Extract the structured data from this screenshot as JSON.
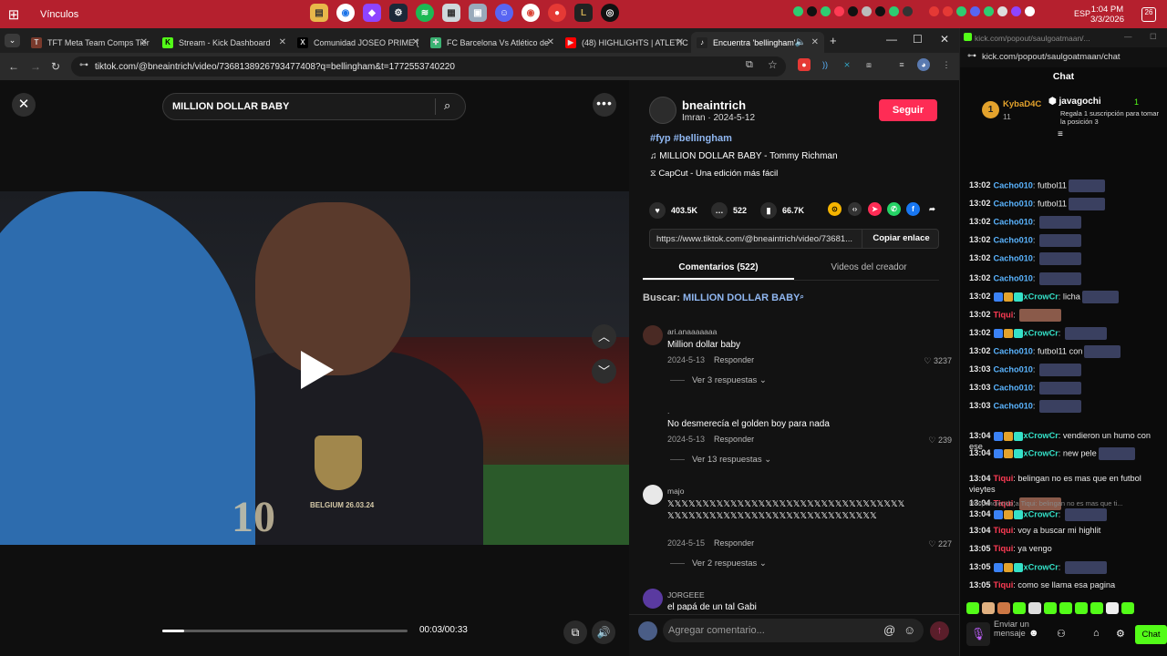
{
  "taskbar": {
    "label": "Vínculos",
    "time": "1:04 PM",
    "date": "3/3/2026",
    "lang": "ESP"
  },
  "browser": {
    "tabs": [
      {
        "label": "TFT Meta Team Comps Tier",
        "icon": "tft-icon",
        "color": "#7a3a2c",
        "glyph": "T"
      },
      {
        "label": "Stream - Kick Dashboard",
        "icon": "kick-icon",
        "color": "#53fc18",
        "glyph": "K"
      },
      {
        "label": "Comunidad JOSEO PRIME (",
        "icon": "x-icon",
        "color": "#000000",
        "glyph": "X"
      },
      {
        "label": "FC Barcelona Vs Atlético de",
        "icon": "globe-icon",
        "color": "#3bb273",
        "glyph": "✚"
      },
      {
        "label": "(48) HIGHLIGHTS | ATLETIC",
        "icon": "youtube-icon",
        "color": "#ff0000",
        "glyph": "▶"
      },
      {
        "label": "Encuentra 'bellingham'",
        "icon": "tiktok-icon",
        "color": "#222222",
        "glyph": "♪"
      }
    ],
    "url": "tiktok.com/@bneaintrich/video/7368138926793477408?q=bellingham&t=1772553740220"
  },
  "video": {
    "search_value": "MILLION DOLLAR BABY",
    "time": "00:03/00:33",
    "progress": 0.09,
    "shirt_text": "BELGIUM 26.03.24",
    "number": "10"
  },
  "post": {
    "username": "bneaintrich",
    "subtitle": "Imran · 2024-5-12",
    "follow_label": "Seguir",
    "tags": "#fyp #bellingham",
    "music": "MILLION DOLLAR BABY - Tommy Richman",
    "capcut": "CapCut - Una edición más fácil",
    "likes": "403.5K",
    "comments": "522",
    "saves": "66.7K",
    "link": "https://www.tiktok.com/@bneaintrich/video/73681...",
    "copy_label": "Copiar enlace",
    "tab_comments": "Comentarios (522)",
    "tab_videos": "Videos del creador",
    "buscar_label": "Buscar:",
    "buscar_query": "MILLION DOLLAR BABY",
    "composer_placeholder": "Agregar comentario..."
  },
  "comments": [
    {
      "user": "ari.anaaaaaaa",
      "text": "Million dollar baby",
      "date": "2024-5-13",
      "reply": "Responder",
      "likes": "3237",
      "replies": "Ver 3 respuestas"
    },
    {
      "user": ".",
      "text": "No desmerecía el golden boy para nada",
      "date": "2024-5-13",
      "reply": "Responder",
      "likes": "239",
      "replies": "Ver 13 respuestas"
    },
    {
      "user": "majo",
      "text": "𝕏𝕏𝕏𝕏𝕏𝕏𝕏𝕏𝕏𝕏𝕏𝕏𝕏𝕏𝕏𝕏𝕏𝕏𝕏𝕏𝕏𝕏𝕏𝕏𝕏𝕏𝕏𝕏𝕏𝕏𝕏𝕏𝕏𝕏𝕏𝕏𝕏𝕏𝕏𝕏𝕏𝕏𝕏𝕏𝕏𝕏𝕏𝕏𝕏𝕏𝕏𝕏𝕏𝕏𝕏𝕏𝕏𝕏𝕏𝕏𝕏𝕏𝕏𝕏",
      "date": "2024-5-15",
      "reply": "Responder",
      "likes": "227",
      "replies": "Ver 2 respuestas"
    },
    {
      "user": "JORGEEE",
      "text": "el papá de un tal Gabi",
      "date": "",
      "reply": "",
      "likes": "",
      "replies": ""
    }
  ],
  "chat": {
    "topbar": "kick.com/popout/saulgoatmaan/...",
    "url": "kick.com/popout/saulgoatmaan/chat",
    "title": "Chat",
    "pinned_user": "KybaD4C",
    "pinned_count": "11",
    "pinned_rank": "1",
    "gifter": "javagochi",
    "gifter_count": "1",
    "gifter_text": "Regala 1 suscripción para tomar la posición 3",
    "lines": [
      {
        "t": "13:02",
        "u": "Cacho010",
        "cls": "blue",
        "m": "futbol11"
      },
      {
        "t": "13:02",
        "u": "Cacho010",
        "cls": "blue",
        "m": "futbol11"
      },
      {
        "t": "13:02",
        "u": "Cacho010",
        "cls": "blue",
        "m": ""
      },
      {
        "t": "13:02",
        "u": "Cacho010",
        "cls": "blue",
        "m": ""
      },
      {
        "t": "13:02",
        "u": "Cacho010",
        "cls": "blue",
        "m": ""
      },
      {
        "t": "13:02",
        "u": "Cacho010",
        "cls": "blue",
        "m": ""
      },
      {
        "t": "13:02",
        "u": "xCrowCr",
        "cls": "teal",
        "m": "licha"
      },
      {
        "t": "13:02",
        "u": "Tiqui",
        "cls": "red",
        "m": ""
      },
      {
        "t": "13:02",
        "u": "xCrowCr",
        "cls": "teal",
        "m": ""
      },
      {
        "t": "13:02",
        "u": "Cacho010",
        "cls": "blue",
        "m": "futbol11 con"
      },
      {
        "t": "13:03",
        "u": "Cacho010",
        "cls": "blue",
        "m": ""
      },
      {
        "t": "13:03",
        "u": "Cacho010",
        "cls": "blue",
        "m": ""
      },
      {
        "t": "13:03",
        "u": "Cacho010",
        "cls": "blue",
        "m": ""
      },
      {
        "t": "13:04",
        "u": "xCrowCr",
        "cls": "teal",
        "m": "vendieron un humo con ese"
      },
      {
        "t": "13:04",
        "u": "xCrowCr",
        "cls": "teal",
        "m": "new pele"
      },
      {
        "t": "13:04",
        "u": "Tiqui",
        "cls": "red",
        "m": "belingan no es mas que en futbol vieytes"
      },
      {
        "t": "13:04",
        "u": "Tiqui",
        "cls": "red",
        "m": ""
      },
      {
        "t": "13:04",
        "u": "xCrowCr",
        "cls": "teal",
        "m": "",
        "reply": "Respondiendo a Tiqui: belingan no es mas que ti..."
      },
      {
        "t": "13:04",
        "u": "Tiqui",
        "cls": "red",
        "m": "voy a buscar mi highlit"
      },
      {
        "t": "13:05",
        "u": "Tiqui",
        "cls": "red",
        "m": "ya vengo"
      },
      {
        "t": "13:05",
        "u": "xCrowCr",
        "cls": "teal",
        "m": ""
      },
      {
        "t": "13:05",
        "u": "Tiqui",
        "cls": "red",
        "m": "como se llama esa pagina"
      }
    ],
    "send_label": "Enviar un mensaje",
    "chat_button": "Chat"
  }
}
